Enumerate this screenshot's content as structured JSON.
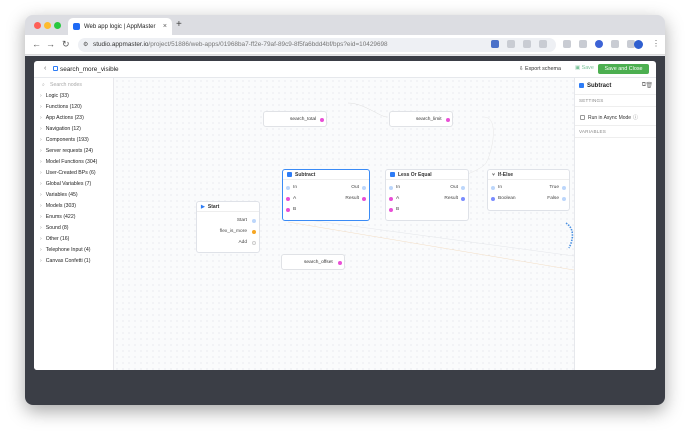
{
  "browser": {
    "tab_title": "Web app logic | AppMaster",
    "url_domain": "studio.appmaster.io",
    "url_path": "/project/51886/web-apps/01968ba7-ff2e-79af-89c9-8f5fa6bdd4bf/bps?eid=10429698"
  },
  "editor": {
    "bp_name": "search_more_visible",
    "export_label": "Export schema",
    "save_label": "Save",
    "save_close_label": "Save and Close",
    "search_placeholder": "Search nodes"
  },
  "categories": [
    "Logic (33)",
    "Functions (120)",
    "App Actions (23)",
    "Navigation (12)",
    "Components (193)",
    "Server requests (24)",
    "Model Functions (304)",
    "User-Created BPs (6)",
    "Global Variables (7)",
    "Variables (45)",
    "Models (303)",
    "Enums (422)",
    "Sound (8)",
    "Other (16)",
    "Telephone Input (4)",
    "Canvas Confetti (1)"
  ],
  "right_panel": {
    "header": "Subtract",
    "settings_label": "SETTINGS",
    "async_label": "Run in Async Mode",
    "variables_label": "VARIABLES"
  },
  "nodes": {
    "start": {
      "title": "Start",
      "out1": "Start",
      "out2": "flex_is_more",
      "out3": "Add"
    },
    "subtract": {
      "title": "Subtract",
      "in": "In",
      "out": "Out",
      "a": "A",
      "b": "B",
      "result": "Result"
    },
    "less_or_equal": {
      "title": "Less Or Equal",
      "in": "In",
      "out": "Out",
      "a": "A",
      "b": "B",
      "result": "Result"
    },
    "ifelse": {
      "title": "If-Else",
      "in": "In",
      "boolean": "Boolean",
      "true": "True",
      "false": "False"
    }
  },
  "pills": {
    "total": "search_total",
    "limit": "search_limit",
    "offset": "search_offset"
  },
  "colors": {
    "accent": "#2d7cf6",
    "save_green": "#4caf50",
    "pin_pink": "#e94fd6",
    "pin_orange": "#f6a623"
  }
}
